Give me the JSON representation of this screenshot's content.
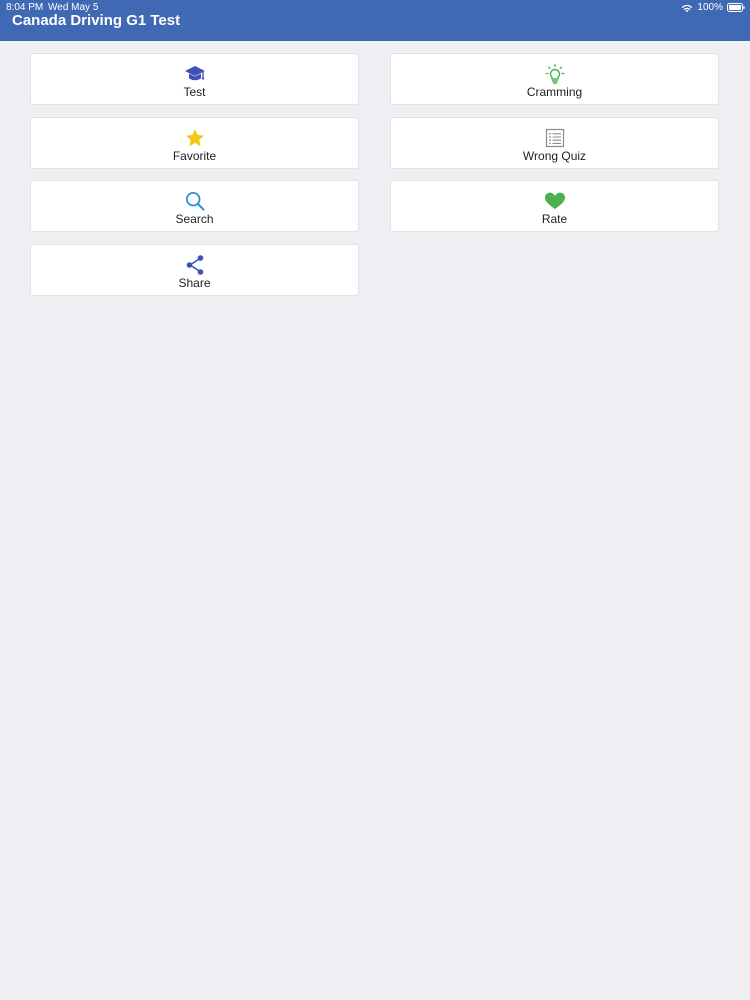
{
  "status_bar": {
    "time": "8:04 PM",
    "date": "Wed May 5",
    "battery": "100%"
  },
  "app": {
    "title": "Canada Driving G1 Test"
  },
  "menu": {
    "items": [
      {
        "label": "Test",
        "icon": "graduation-cap-icon",
        "color": "#3f51b5"
      },
      {
        "label": "Cramming",
        "icon": "lightbulb-icon",
        "color": "#4caf50"
      },
      {
        "label": "Favorite",
        "icon": "star-icon",
        "color": "#f5c518"
      },
      {
        "label": "Wrong Quiz",
        "icon": "list-icon",
        "color": "#8a8a8a"
      },
      {
        "label": "Search",
        "icon": "search-icon",
        "color": "#2a8fd8"
      },
      {
        "label": "Rate",
        "icon": "heart-icon",
        "color": "#4caf50"
      },
      {
        "label": "Share",
        "icon": "share-icon",
        "color": "#3f51b5"
      }
    ]
  }
}
